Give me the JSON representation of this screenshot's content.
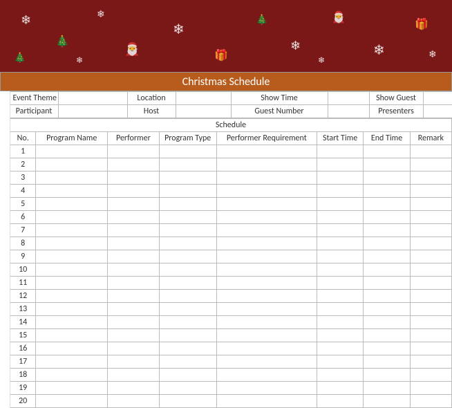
{
  "title": "Christmas  Schedule",
  "meta_row1": {
    "event_theme_label": "Event Theme",
    "event_theme_value": "",
    "location_label": "Location",
    "location_value": "",
    "show_time_label": "Show Time",
    "show_time_value": "",
    "show_guest_label": "Show Guest",
    "show_guest_value": ""
  },
  "meta_row2": {
    "participant_label": "Participant",
    "participant_value": "",
    "host_label": "Host",
    "host_value": "",
    "guest_number_label": "Guest Number",
    "guest_number_value": "",
    "presenters_label": "Presenters",
    "presenters_value": ""
  },
  "schedule_heading": "Schedule",
  "columns": {
    "no": "No.",
    "program_name": "Program Name",
    "performer": "Performer",
    "program_type": "Program Type",
    "performer_requirement": "Performer Requirement",
    "start_time": "Start Time",
    "end_time": "End Time",
    "remark": "Remark"
  },
  "rows": [
    {
      "no": "1",
      "program_name": "",
      "performer": "",
      "program_type": "",
      "performer_requirement": "",
      "start_time": "",
      "end_time": "",
      "remark": ""
    },
    {
      "no": "2",
      "program_name": "",
      "performer": "",
      "program_type": "",
      "performer_requirement": "",
      "start_time": "",
      "end_time": "",
      "remark": ""
    },
    {
      "no": "3",
      "program_name": "",
      "performer": "",
      "program_type": "",
      "performer_requirement": "",
      "start_time": "",
      "end_time": "",
      "remark": ""
    },
    {
      "no": "4",
      "program_name": "",
      "performer": "",
      "program_type": "",
      "performer_requirement": "",
      "start_time": "",
      "end_time": "",
      "remark": ""
    },
    {
      "no": "5",
      "program_name": "",
      "performer": "",
      "program_type": "",
      "performer_requirement": "",
      "start_time": "",
      "end_time": "",
      "remark": ""
    },
    {
      "no": "6",
      "program_name": "",
      "performer": "",
      "program_type": "",
      "performer_requirement": "",
      "start_time": "",
      "end_time": "",
      "remark": ""
    },
    {
      "no": "7",
      "program_name": "",
      "performer": "",
      "program_type": "",
      "performer_requirement": "",
      "start_time": "",
      "end_time": "",
      "remark": ""
    },
    {
      "no": "8",
      "program_name": "",
      "performer": "",
      "program_type": "",
      "performer_requirement": "",
      "start_time": "",
      "end_time": "",
      "remark": ""
    },
    {
      "no": "9",
      "program_name": "",
      "performer": "",
      "program_type": "",
      "performer_requirement": "",
      "start_time": "",
      "end_time": "",
      "remark": ""
    },
    {
      "no": "10",
      "program_name": "",
      "performer": "",
      "program_type": "",
      "performer_requirement": "",
      "start_time": "",
      "end_time": "",
      "remark": ""
    },
    {
      "no": "11",
      "program_name": "",
      "performer": "",
      "program_type": "",
      "performer_requirement": "",
      "start_time": "",
      "end_time": "",
      "remark": ""
    },
    {
      "no": "12",
      "program_name": "",
      "performer": "",
      "program_type": "",
      "performer_requirement": "",
      "start_time": "",
      "end_time": "",
      "remark": ""
    },
    {
      "no": "13",
      "program_name": "",
      "performer": "",
      "program_type": "",
      "performer_requirement": "",
      "start_time": "",
      "end_time": "",
      "remark": ""
    },
    {
      "no": "14",
      "program_name": "",
      "performer": "",
      "program_type": "",
      "performer_requirement": "",
      "start_time": "",
      "end_time": "",
      "remark": ""
    },
    {
      "no": "15",
      "program_name": "",
      "performer": "",
      "program_type": "",
      "performer_requirement": "",
      "start_time": "",
      "end_time": "",
      "remark": ""
    },
    {
      "no": "16",
      "program_name": "",
      "performer": "",
      "program_type": "",
      "performer_requirement": "",
      "start_time": "",
      "end_time": "",
      "remark": ""
    },
    {
      "no": "17",
      "program_name": "",
      "performer": "",
      "program_type": "",
      "performer_requirement": "",
      "start_time": "",
      "end_time": "",
      "remark": ""
    },
    {
      "no": "18",
      "program_name": "",
      "performer": "",
      "program_type": "",
      "performer_requirement": "",
      "start_time": "",
      "end_time": "",
      "remark": ""
    },
    {
      "no": "19",
      "program_name": "",
      "performer": "",
      "program_type": "",
      "performer_requirement": "",
      "start_time": "",
      "end_time": "",
      "remark": ""
    },
    {
      "no": "20",
      "program_name": "",
      "performer": "",
      "program_type": "",
      "performer_requirement": "",
      "start_time": "",
      "end_time": "",
      "remark": ""
    }
  ]
}
